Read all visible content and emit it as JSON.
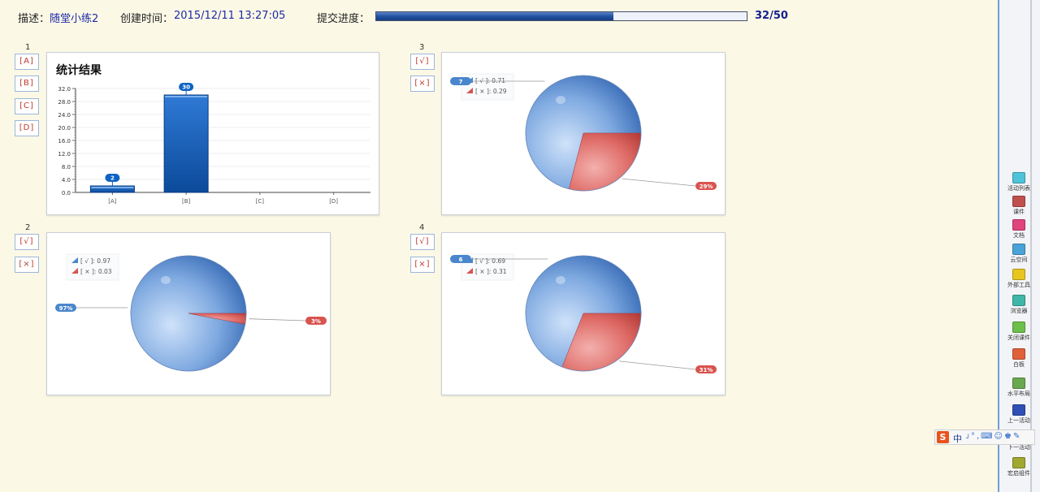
{
  "header": {
    "desc_label": "描述：",
    "desc_value": "随堂小练2",
    "created_label": "创建时间：",
    "created_value": "2015/12/11 13:27:05",
    "progress_label": "提交进度：",
    "progress_fraction": 0.64,
    "progress_count": "32/50"
  },
  "colors": {
    "blue_slice": "#4a86cc",
    "red_slice": "#d9534f",
    "bar": "#0d5cb5",
    "accent": "#1d2aa8"
  },
  "questions": [
    {
      "number": "1",
      "options": [
        "[A]",
        "[B]",
        "[C]",
        "[D]"
      ],
      "chart_title": "统计结果"
    },
    {
      "number": "2",
      "options": [
        "[√]",
        "[×]"
      ],
      "legend": [
        "[ √ ]: 0.97",
        "[ × ]: 0.03"
      ],
      "slice_labels": [
        "97%",
        "3%"
      ]
    },
    {
      "number": "3",
      "options": [
        "[√]",
        "[×]"
      ],
      "legend": [
        "[ √ ]: 0.71",
        "[ × ]: 0.29"
      ],
      "slice_labels": [
        "7",
        "29%"
      ]
    },
    {
      "number": "4",
      "options": [
        "[√]",
        "[×]"
      ],
      "legend": [
        "[ √ ]: 0.69",
        "[ × ]: 0.31"
      ],
      "slice_labels": [
        "6",
        "31%"
      ]
    }
  ],
  "chart_data": [
    {
      "type": "bar",
      "title": "统计结果",
      "categories": [
        "[A]",
        "[B]",
        "[C]",
        "[D]"
      ],
      "values": [
        2,
        30,
        0,
        0
      ],
      "data_labels": [
        "2",
        "30"
      ],
      "yticks": [
        "0.0",
        "4.0",
        "8.0",
        "12.0",
        "16.0",
        "20.0",
        "24.0",
        "28.0",
        "32.0"
      ],
      "ylim": [
        0,
        32
      ],
      "grid": true
    },
    {
      "type": "pie",
      "categories": [
        "[ √ ]",
        "[ × ]"
      ],
      "values": [
        0.97,
        0.03
      ],
      "legend": "top-left"
    },
    {
      "type": "pie",
      "categories": [
        "[ √ ]",
        "[ × ]"
      ],
      "values": [
        0.71,
        0.29
      ],
      "legend": "top-left"
    },
    {
      "type": "pie",
      "categories": [
        "[ √ ]",
        "[ × ]"
      ],
      "values": [
        0.69,
        0.31
      ],
      "legend": "top-left"
    }
  ],
  "sidebar_tools": [
    {
      "label": "活动列表",
      "icon": "list-icon",
      "color": "#4fc3d9"
    },
    {
      "label": "课件",
      "icon": "courseware-icon",
      "color": "#c0504d"
    },
    {
      "label": "文档",
      "icon": "document-icon",
      "color": "#e0457b"
    },
    {
      "label": "云空间",
      "icon": "cloud-icon",
      "color": "#4aa3d8"
    },
    {
      "label": "外部工具",
      "icon": "folder-icon",
      "color": "#e8c61e"
    },
    {
      "label": "浏览器",
      "icon": "browser-icon",
      "color": "#3fb6a8"
    },
    {
      "label": "关闭课件",
      "icon": "close-courseware-icon",
      "color": "#6cc04a"
    },
    {
      "label": "白板",
      "icon": "whiteboard-icon",
      "color": "#e0603a"
    },
    {
      "label": "水平布局",
      "icon": "layout-icon",
      "color": "#6aa84f"
    },
    {
      "label": "上一活动",
      "icon": "prev-activity-icon",
      "color": "#2f4fb5"
    },
    {
      "label": "下一活动",
      "icon": "next-activity-icon",
      "color": "#2f4fb5"
    },
    {
      "label": "宏启组件",
      "icon": "component-icon",
      "color": "#a0a830"
    }
  ],
  "ime": {
    "logo": "S",
    "mode": "中",
    "icons": "ᴊ°,⌨☺♚✎"
  }
}
